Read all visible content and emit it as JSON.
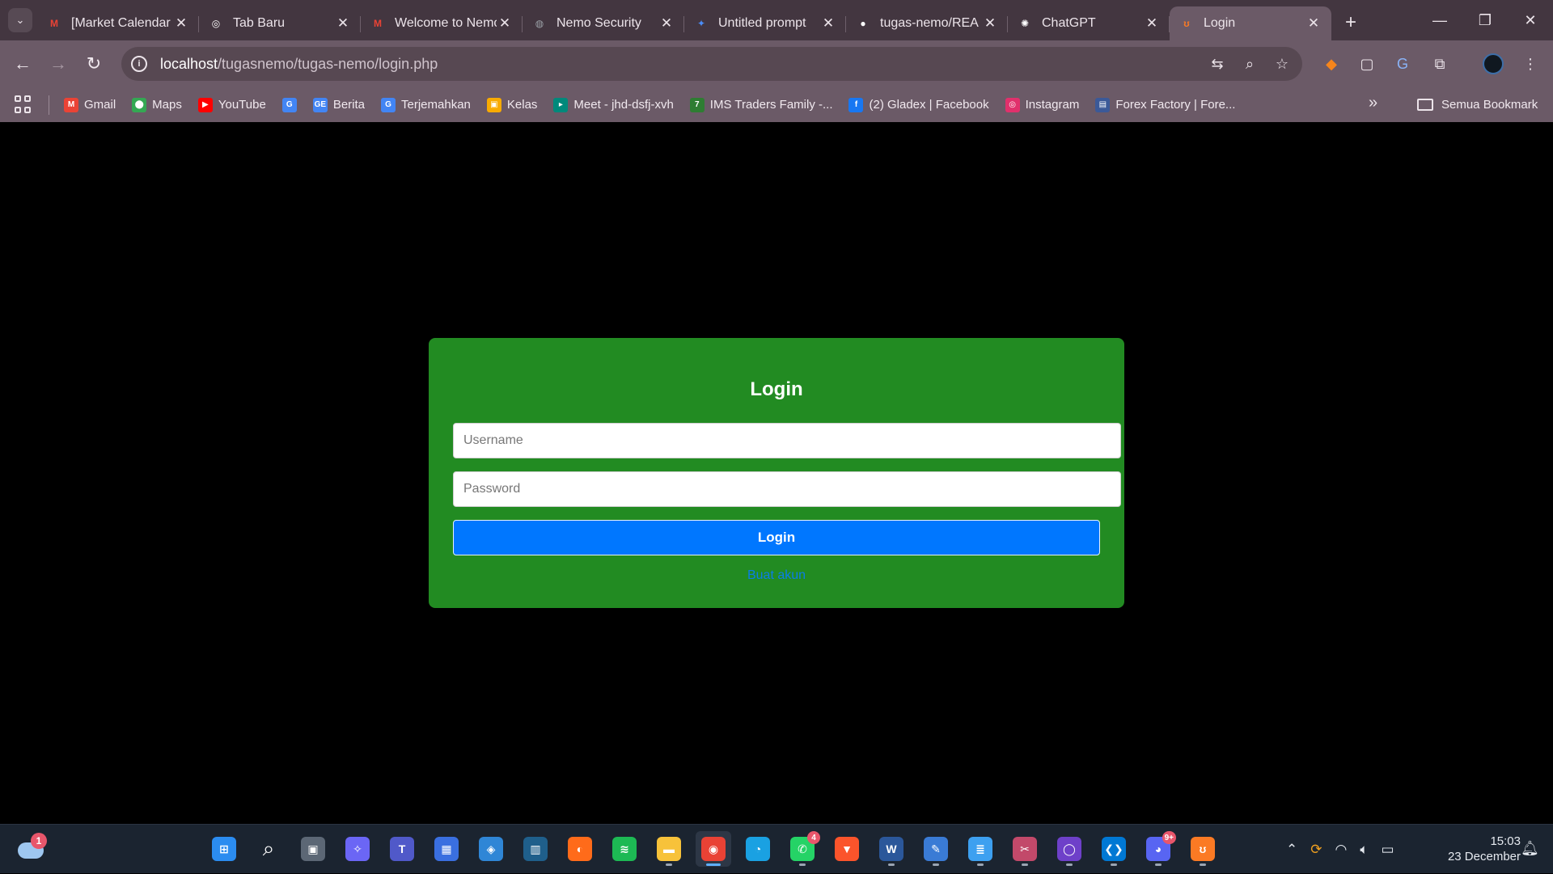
{
  "browser": {
    "tabs": [
      {
        "title": "[Market Calendar",
        "icon": "gmail-icon",
        "favColor": "#ea4335",
        "favText": "M",
        "active": false
      },
      {
        "title": "Tab Baru",
        "icon": "chrome-icon",
        "favColor": "#ffffff",
        "favText": "◎",
        "active": false
      },
      {
        "title": "Welcome to Nemo",
        "icon": "gmail-icon",
        "favColor": "#ea4335",
        "favText": "M",
        "active": false
      },
      {
        "title": "Nemo Security",
        "icon": "globe-icon",
        "favColor": "#9aa0a6",
        "favText": "◍",
        "active": false
      },
      {
        "title": "Untitled prompt",
        "icon": "ai-studio-icon",
        "favColor": "#4b8df8",
        "favText": "✦",
        "active": false
      },
      {
        "title": "tugas-nemo/REA",
        "icon": "github-icon",
        "favColor": "#ffffff",
        "favText": "●",
        "active": false
      },
      {
        "title": "ChatGPT",
        "icon": "chatgpt-icon",
        "favColor": "#ffffff",
        "favText": "✺",
        "active": false
      },
      {
        "title": "Login",
        "icon": "xampp-icon",
        "favColor": "#fb7a24",
        "favText": "ʊ",
        "active": true
      }
    ],
    "url_host": "localhost",
    "url_path": "/tugasnemo/tugas-nemo/login.php",
    "bookmarks": [
      {
        "label": "Gmail",
        "icon": "gmail-icon",
        "color": "#ea4335",
        "glyph": "M"
      },
      {
        "label": "Maps",
        "icon": "maps-icon",
        "color": "#34a853",
        "glyph": "⬤"
      },
      {
        "label": "YouTube",
        "icon": "youtube-icon",
        "color": "#ff0000",
        "glyph": "▶"
      },
      {
        "label": "",
        "icon": "google-icon",
        "color": "#4285f4",
        "glyph": "G"
      },
      {
        "label": "Berita",
        "icon": "news-icon",
        "color": "#4285f4",
        "glyph": "GE"
      },
      {
        "label": "Terjemahkan",
        "icon": "translate-icon",
        "color": "#4285f4",
        "glyph": "G"
      },
      {
        "label": "Kelas",
        "icon": "classroom-icon",
        "color": "#f9ab00",
        "glyph": "▣"
      },
      {
        "label": "Meet - jhd-dsfj-xvh",
        "icon": "meet-icon",
        "color": "#00897b",
        "glyph": "▸"
      },
      {
        "label": "IMS Traders Family -...",
        "icon": "ims-icon",
        "color": "#2e7d32",
        "glyph": "7"
      },
      {
        "label": "(2) Gladex | Facebook",
        "icon": "facebook-icon",
        "color": "#1877f2",
        "glyph": "f"
      },
      {
        "label": "Instagram",
        "icon": "instagram-icon",
        "color": "#e1306c",
        "glyph": "◎"
      },
      {
        "label": "Forex Factory | Fore...",
        "icon": "forexfactory-icon",
        "color": "#3b5998",
        "glyph": "▤"
      }
    ],
    "all_bookmarks_label": "Semua Bookmark"
  },
  "login": {
    "title": "Login",
    "username_placeholder": "Username",
    "password_placeholder": "Password",
    "button_label": "Login",
    "register_link": "Buat akun"
  },
  "taskbar": {
    "weather_badge": "1",
    "apps": [
      {
        "name": "start-button",
        "color": "#2b8cf0",
        "glyph": "⊞",
        "running": false,
        "badge": ""
      },
      {
        "name": "search-icon",
        "color": "transparent",
        "glyph": "⌕",
        "running": false,
        "badge": ""
      },
      {
        "name": "task-view-icon",
        "color": "#5c6775",
        "glyph": "▣",
        "running": false,
        "badge": ""
      },
      {
        "name": "copilot-icon",
        "color": "#6b66f5",
        "glyph": "✧",
        "running": false,
        "badge": ""
      },
      {
        "name": "teams-icon",
        "color": "#5059c9",
        "glyph": "T",
        "running": false,
        "badge": ""
      },
      {
        "name": "ms-store-icon",
        "color": "#3a6fe0",
        "glyph": "▦",
        "running": false,
        "badge": ""
      },
      {
        "name": "maps-app-icon",
        "color": "#2f86d6",
        "glyph": "◈",
        "running": false,
        "badge": ""
      },
      {
        "name": "app-icon",
        "color": "#1f5f8b",
        "glyph": "▥",
        "running": false,
        "badge": ""
      },
      {
        "name": "firefox-icon",
        "color": "#ff6b1a",
        "glyph": "◐",
        "running": false,
        "badge": ""
      },
      {
        "name": "spotify-icon",
        "color": "#1db954",
        "glyph": "≋",
        "running": false,
        "badge": ""
      },
      {
        "name": "file-explorer-icon",
        "color": "#f7c23a",
        "glyph": "▬",
        "running": true,
        "badge": ""
      },
      {
        "name": "chrome-icon",
        "color": "#e94235",
        "glyph": "◉",
        "running": true,
        "badge": "",
        "active": true
      },
      {
        "name": "edge-icon",
        "color": "#1aa1e2",
        "glyph": "◔",
        "running": false,
        "badge": ""
      },
      {
        "name": "whatsapp-icon",
        "color": "#25d366",
        "glyph": "✆",
        "running": true,
        "badge": "4"
      },
      {
        "name": "brave-icon",
        "color": "#fb542b",
        "glyph": "▼",
        "running": false,
        "badge": ""
      },
      {
        "name": "word-icon",
        "color": "#2b579a",
        "glyph": "W",
        "running": true,
        "badge": ""
      },
      {
        "name": "app-installer-icon",
        "color": "#3a7bd5",
        "glyph": "✎",
        "running": true,
        "badge": ""
      },
      {
        "name": "notepad-icon",
        "color": "#3da0f0",
        "glyph": "≣",
        "running": true,
        "badge": ""
      },
      {
        "name": "snipping-tool-icon",
        "color": "#c2496a",
        "glyph": "✂",
        "running": true,
        "badge": ""
      },
      {
        "name": "github-desktop-icon",
        "color": "#6e40c9",
        "glyph": "◯",
        "running": true,
        "badge": ""
      },
      {
        "name": "vscode-icon",
        "color": "#0078d4",
        "glyph": "❮❯",
        "running": true,
        "badge": ""
      },
      {
        "name": "discord-icon",
        "color": "#5865f2",
        "glyph": "◕",
        "running": true,
        "badge": "9+"
      },
      {
        "name": "xampp-icon",
        "color": "#fb7a24",
        "glyph": "ʊ",
        "running": true,
        "badge": ""
      }
    ],
    "time": "15:03",
    "date": "23 December"
  }
}
